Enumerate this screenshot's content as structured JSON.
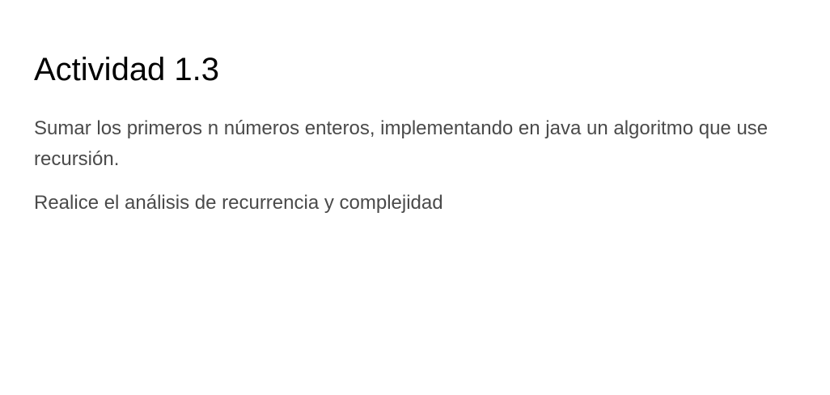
{
  "page": {
    "title": "Actividad 1.3",
    "description": "Sumar los primeros n números enteros, implementando en java un algoritmo que use recursión.",
    "task": "Realice el análisis de recurrencia y complejidad"
  },
  "colors": {
    "background": "#ffffff",
    "title": "#000000",
    "body_text": "#4a4a4a"
  }
}
